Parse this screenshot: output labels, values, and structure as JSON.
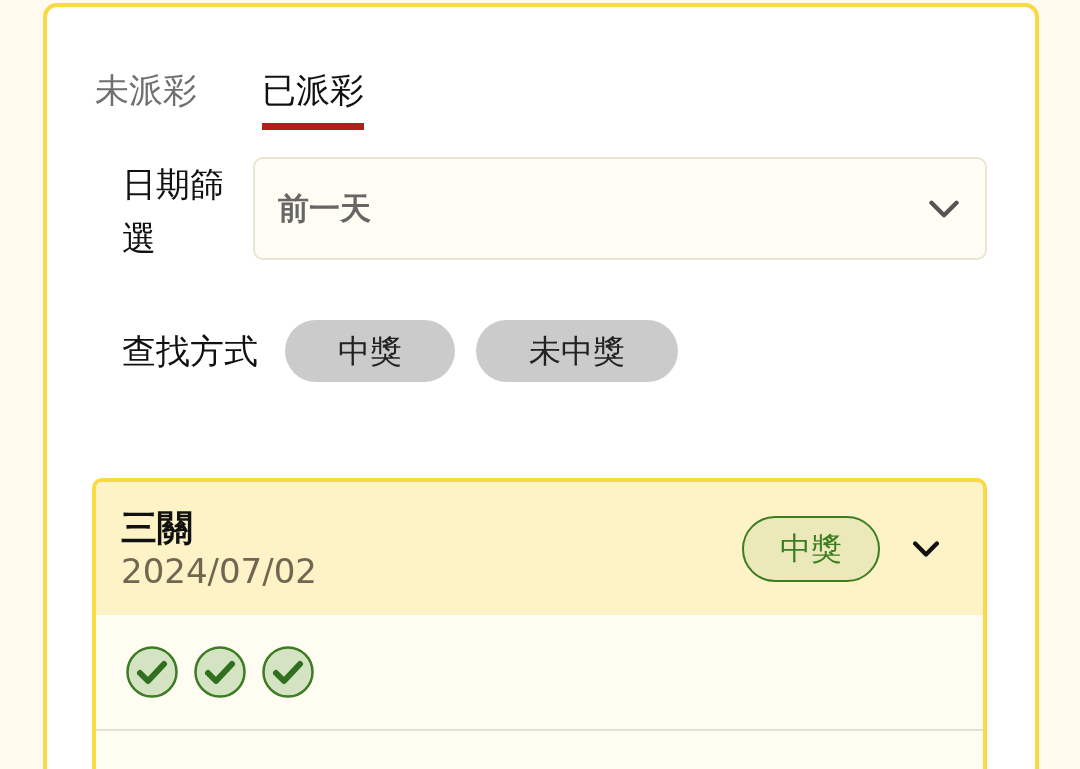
{
  "tabs": [
    {
      "label": "未派彩",
      "selected": false
    },
    {
      "label": "已派彩",
      "selected": true
    }
  ],
  "date_filter": {
    "label": "日期篩選",
    "value": "前一天"
  },
  "search_mode": {
    "label": "查找方式",
    "options": [
      {
        "label": "中獎",
        "selected": false
      },
      {
        "label": "未中獎",
        "selected": false
      }
    ]
  },
  "results": [
    {
      "title": "三關",
      "date": "2024/07/02",
      "badge": "中獎",
      "legs": [
        {
          "kind": "won"
        },
        {
          "kind": "won"
        },
        {
          "kind": "won"
        }
      ]
    }
  ]
}
